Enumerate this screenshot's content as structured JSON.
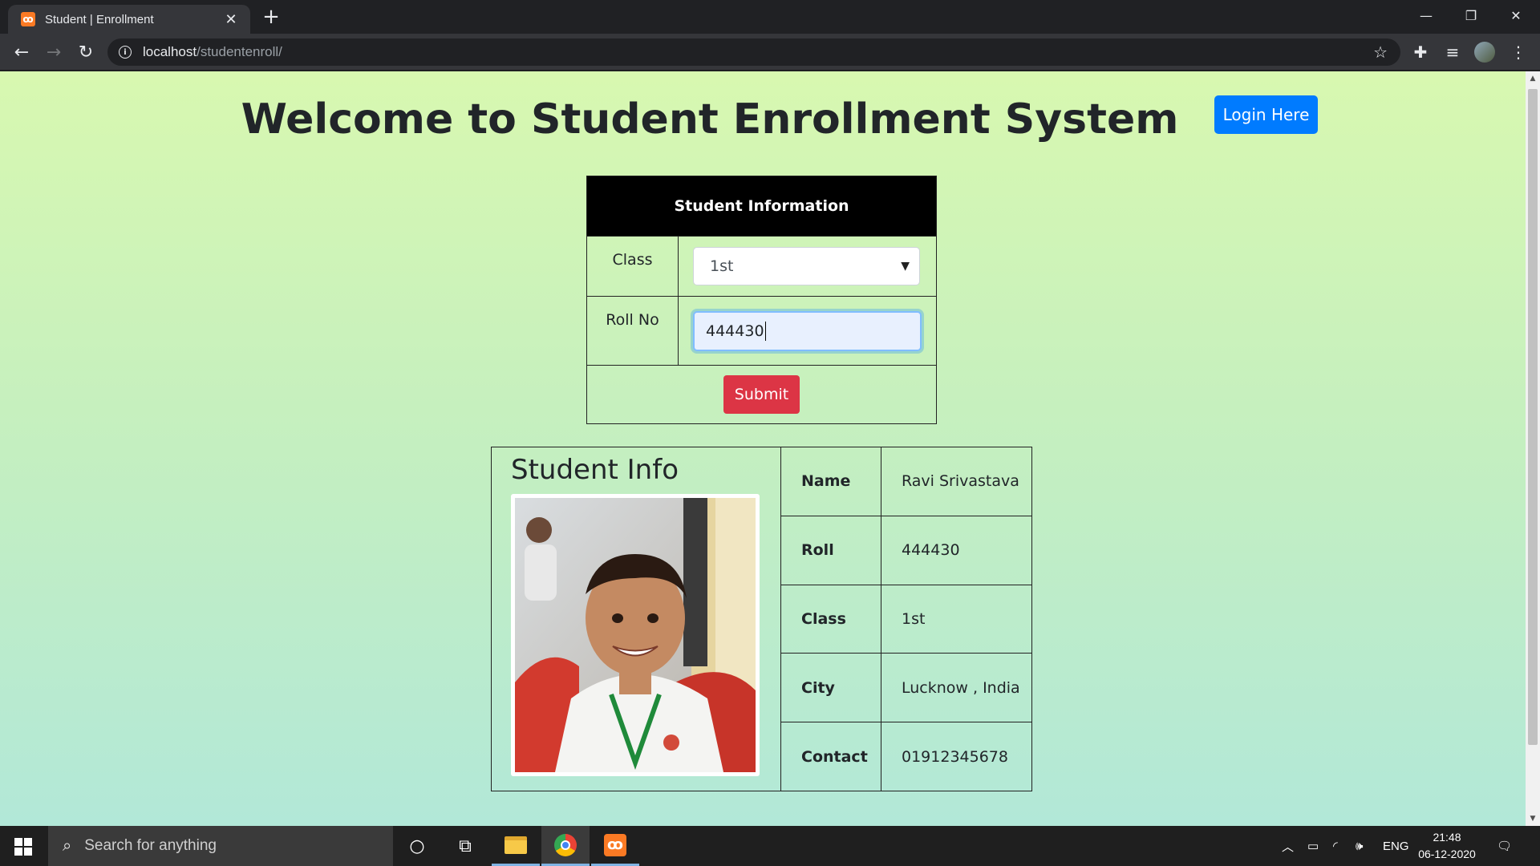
{
  "browser": {
    "tab_title": "Student | Enrollment",
    "tab_favicon": "xampp-icon",
    "url_host": "localhost",
    "url_path": "/studentenroll/"
  },
  "page": {
    "heading": "Welcome to Student Enrollment System",
    "login_button": "Login Here",
    "form": {
      "title": "Student Information",
      "class_label": "Class",
      "class_value": "1st",
      "roll_label": "Roll No",
      "roll_value": "444430",
      "submit_label": "Submit"
    },
    "info": {
      "title": "Student Info",
      "rows": [
        {
          "key": "Name",
          "value": "Ravi Srivastava"
        },
        {
          "key": "Roll",
          "value": "444430"
        },
        {
          "key": "Class",
          "value": "1st"
        },
        {
          "key": "City",
          "value": "Lucknow , India"
        },
        {
          "key": "Contact",
          "value": "01912345678"
        }
      ]
    }
  },
  "taskbar": {
    "search_placeholder": "Search for anything",
    "language": "ENG",
    "time": "21:48",
    "date": "06-12-2020"
  },
  "colors": {
    "login_button": "#007bff",
    "submit_button": "#dc3545",
    "form_header": "#000000",
    "page_gradient_top": "#d8f8b0",
    "page_gradient_bottom": "#b2e8d8"
  }
}
